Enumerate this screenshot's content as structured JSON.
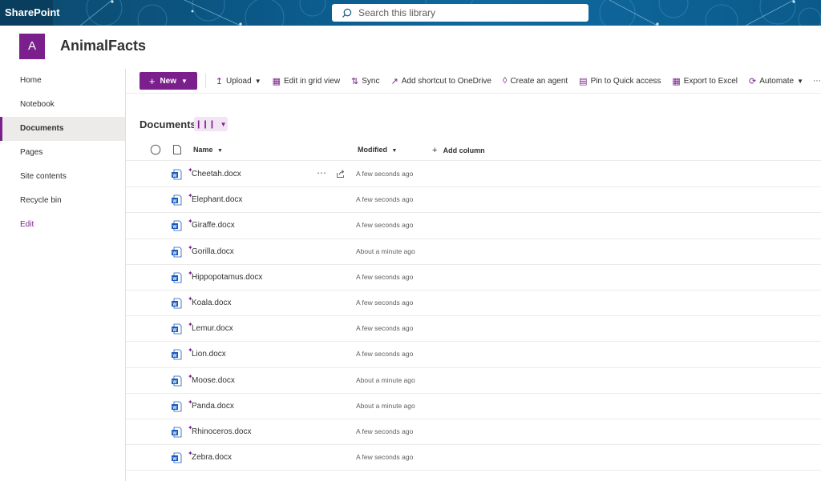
{
  "suitebar": {
    "brand": "SharePoint",
    "search_placeholder": "Search this library"
  },
  "site": {
    "logo_letter": "A",
    "title": "AnimalFacts"
  },
  "nav": {
    "items": [
      "Home",
      "Notebook",
      "Documents",
      "Pages",
      "Site contents",
      "Recycle bin"
    ],
    "active": "Documents",
    "edit_label": "Edit"
  },
  "commands": {
    "new": "New",
    "upload": "Upload",
    "edit_grid": "Edit in grid view",
    "sync": "Sync",
    "add_shortcut": "Add shortcut to OneDrive",
    "create_agent": "Create an agent",
    "pin_quick": "Pin to Quick access",
    "export_excel": "Export to Excel",
    "automate": "Automate",
    "more": "⋯"
  },
  "library": {
    "title": "Documents",
    "columns": {
      "name": "Name",
      "modified": "Modified",
      "add_column": "Add column"
    },
    "files": [
      {
        "name": "Cheetah.docx",
        "modified": "A few seconds ago"
      },
      {
        "name": "Elephant.docx",
        "modified": "A few seconds ago"
      },
      {
        "name": "Giraffe.docx",
        "modified": "A few seconds ago"
      },
      {
        "name": "Gorilla.docx",
        "modified": "About a minute ago"
      },
      {
        "name": "Hippopotamus.docx",
        "modified": "A few seconds ago"
      },
      {
        "name": "Koala.docx",
        "modified": "A few seconds ago"
      },
      {
        "name": "Lemur.docx",
        "modified": "A few seconds ago"
      },
      {
        "name": "Lion.docx",
        "modified": "A few seconds ago"
      },
      {
        "name": "Moose.docx",
        "modified": "About a minute ago"
      },
      {
        "name": "Panda.docx",
        "modified": "About a minute ago"
      },
      {
        "name": "Rhinoceros.docx",
        "modified": "A few seconds ago"
      },
      {
        "name": "Zebra.docx",
        "modified": "A few seconds ago"
      }
    ]
  },
  "colors": {
    "accent": "#7b1f8c",
    "suitebar": "#0b5a8a",
    "word_blue": "#185abd"
  }
}
